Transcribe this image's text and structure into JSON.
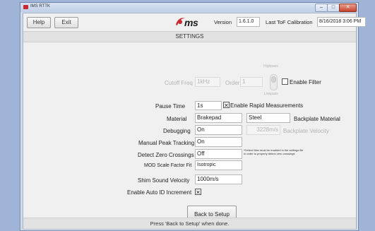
{
  "window": {
    "title": "IMS RTTK"
  },
  "toolbar": {
    "help_label": "Help",
    "exit_label": "Exit"
  },
  "header": {
    "logo_text": "ms",
    "version_label": "Version",
    "version_value": "1.6.1.0",
    "calibration_label": "Last ToF Calibration",
    "calibration_value": "8/16/2018 3:06 PM"
  },
  "settings": {
    "title": "SETTINGS",
    "filter": {
      "cutoff_label": "Cutoff Freq",
      "cutoff_value": "1kHz",
      "order_label": "Order",
      "order_value": "1",
      "highpass_label": "Highpass",
      "lowpass_label": "Lowpass",
      "enable_label": "Enable Filter",
      "enabled": false
    },
    "pause_time": {
      "label": "Pause Time",
      "value": "1s"
    },
    "rapid": {
      "label": "Enable Rapid Measurements",
      "checked": true,
      "mark": "✕"
    },
    "material": {
      "label": "Material",
      "value": "Brakepad"
    },
    "backplate_material": {
      "label": "Backplate Material",
      "value": "Steel"
    },
    "backplate_velocity": {
      "label": "Backplate Velocity",
      "value": "3228m/s"
    },
    "debugging": {
      "label": "Debugging",
      "value": "On"
    },
    "manual_peak": {
      "label": "Manual Peak Tracking",
      "value": "On"
    },
    "zero_crossings": {
      "label": "Detect Zero Crossings",
      "value": "Off",
      "note_line1": "*Detect Max must be enabled in the settings file",
      "note_line2": "in order to properly detect zero crossings"
    },
    "mod_scale": {
      "label": "MOD Scale Factor Fit",
      "value": "Isotropic"
    },
    "shim_velocity": {
      "label": "Shim Sound Velocity",
      "value": "1000m/s"
    },
    "auto_id": {
      "label": "Enable Auto ID Increment",
      "checked": true,
      "mark": "✕"
    }
  },
  "back_button": {
    "label": "Back to Setup"
  },
  "status": {
    "text": "Press 'Back to Setup' when done."
  },
  "colors": {
    "logo_red": "#c8282e",
    "window_frame": "#6f86ad",
    "close_red": "#c7432c"
  }
}
